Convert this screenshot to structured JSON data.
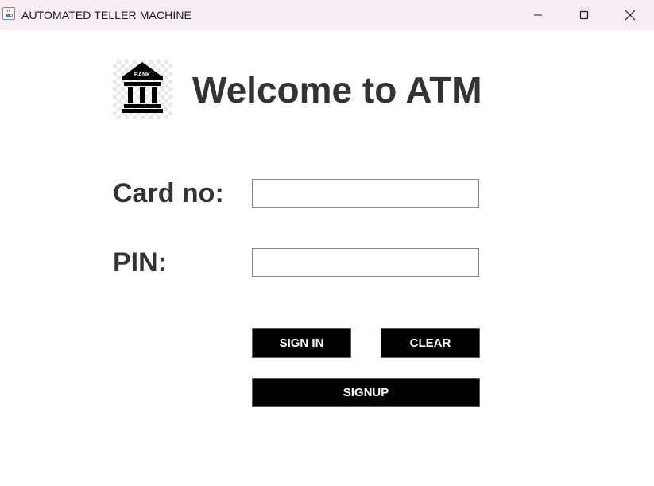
{
  "window": {
    "title": "AUTOMATED TELLER MACHINE",
    "app_icon": "java-cup-icon",
    "controls": [
      "minimize-icon",
      "maximize-icon",
      "close-icon"
    ],
    "titlebar_color": "#f6eef4"
  },
  "header": {
    "logo_icon": "bank-building-icon",
    "logo_text": "BANK",
    "title": "Welcome to ATM"
  },
  "form": {
    "card_label": "Card no:",
    "card_value": "",
    "pin_label": "PIN:",
    "pin_value": ""
  },
  "buttons": {
    "sign_in": "SIGN IN",
    "clear": "CLEAR",
    "signup": "SIGNUP",
    "background": "#000000",
    "text_color": "#ffffff"
  },
  "colors": {
    "text": "#333333",
    "field_border": "#7a8a94"
  }
}
